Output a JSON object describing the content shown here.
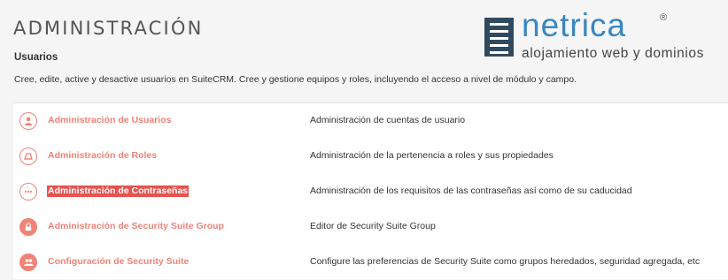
{
  "page": {
    "title": "ADMINISTRACIÓN"
  },
  "logo": {
    "brand": "netrica",
    "registered": "®",
    "tagline": "alojamiento web y dominios"
  },
  "section": {
    "title": "Usuarios",
    "description": "Cree, edite, active y desactive usuarios en SuiteCRM. Cree y gestione equipos y roles, incluyendo el acceso a nivel de módulo y campo."
  },
  "rows": [
    {
      "label": "Administración de Usuarios",
      "description": "Administración de cuentas de usuario",
      "icon": "user-icon"
    },
    {
      "label": "Administración de Roles",
      "description": "Administración de la pertenencia a roles y sus propiedades",
      "icon": "roles-icon"
    },
    {
      "label": "Administración de Contraseñas",
      "description": "Administración de los requisitos de las contraseñas así como de su caducidad",
      "icon": "password-icon",
      "selected": true
    },
    {
      "label": "Administración de Security Suite Group",
      "description": "Editor de Security Suite Group",
      "icon": "lock-icon"
    },
    {
      "label": "Configuración de Security Suite",
      "description": "Configure las preferencias de Security Suite como grupos heredados, seguridad agregada, etc",
      "icon": "group-icon"
    }
  ],
  "colors": {
    "accent": "#f08377",
    "highlight": "#e8524e",
    "logo_blue": "#3a86c0",
    "logo_dark": "#2f4a5e"
  }
}
